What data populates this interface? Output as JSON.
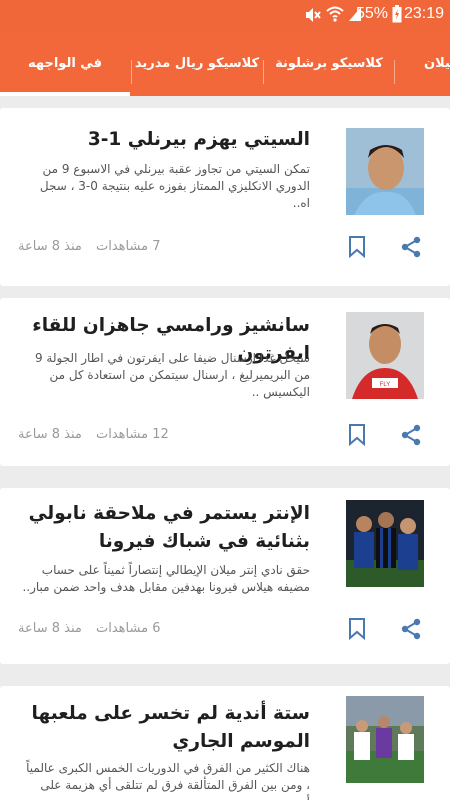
{
  "status_bar": {
    "time": "23:19",
    "battery_percent": "55%",
    "icons": [
      "mute-icon",
      "wifi-icon",
      "signal-icon",
      "battery-icon"
    ]
  },
  "tabs": [
    {
      "label": "في الواجهه",
      "active": true
    },
    {
      "label": "كلاسيكو ريال مدريد",
      "active": false
    },
    {
      "label": "كلاسيكو برشلونة",
      "active": false
    },
    {
      "label": "ميلان",
      "active": false
    }
  ],
  "colors": {
    "accent": "#f2683a",
    "background": "#ececec"
  },
  "articles": [
    {
      "title": "السيتي يهزم بيرنلي 1-3",
      "excerpt": "تمكن السيتي من تجاوز عقبة بيرنلي في الاسبوع 9 من الدوري الانكليزي الممتاز بفوزه عليه بنتيجة 0-3 ، سجل اه..",
      "views": "7 مشاهدات",
      "time": "منذ 8 ساعة"
    },
    {
      "title": "سانشيز ورامسي جاهزان للقاء ايفرتون",
      "excerpt": "سيحل غدا ارسنال ضيفا على ايفرتون في اطار الجولة 9 من البريميرليغ ، ارسنال سيتمكن من استعادة كل من اليكسيس ..",
      "views": "12 مشاهدات",
      "time": "منذ 8 ساعة"
    },
    {
      "title": "الإنتر يستمر في ملاحقة نابولي بثنائية في شباك فيرونا",
      "excerpt": "حقق نادي إنتر ميلان الإيطالي إنتصاراً ثميناً على حساب مضيفه هيلاس فيرونا بهدفين مقابل هدف واحد ضمن مبار..",
      "views": "6 مشاهدات",
      "time": "منذ 8 ساعة"
    },
    {
      "title": "ستة أندية لم تخسر على ملعبها الموسم الجاري",
      "excerpt": "هناك الكثير من الفرق في الدوريات الخمس الكبرى عالمياً ، ومن بين الفرق المتألقة فرق لم تتلقى أي هزيمة على أرضية ..",
      "views": "",
      "time": ""
    }
  ]
}
